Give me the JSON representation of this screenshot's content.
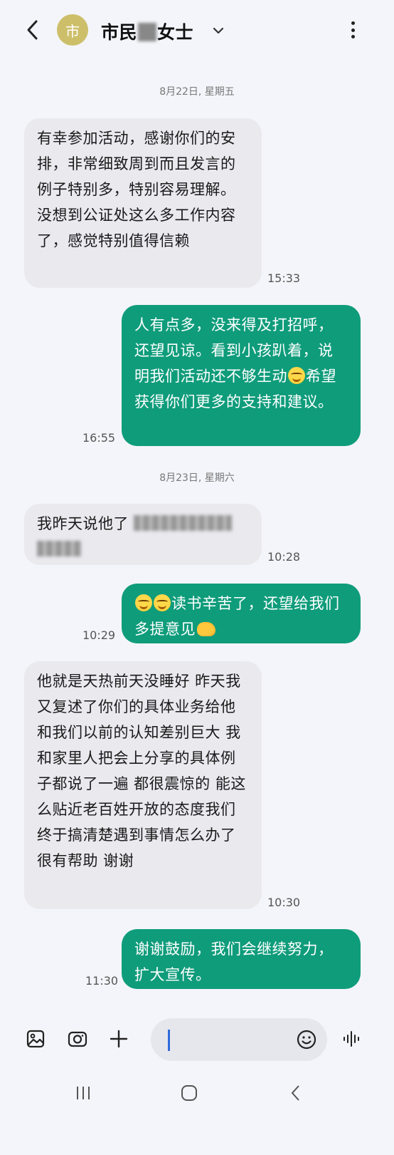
{
  "header": {
    "avatar_char": "市",
    "name_prefix": "市民",
    "name_suffix": "女士"
  },
  "messages": [
    {
      "type": "date",
      "text": "8月22日, 星期五"
    },
    {
      "type": "in",
      "text": "有幸参加活动，感谢你们的安排，非常细致周到而且发言的例子特别多，特别容易理解。没想到公证处这么多工作内容了，感觉特别值得信赖",
      "time": "15:33"
    },
    {
      "type": "out",
      "text_a": "人有点多，没来得及打招呼，还望见谅。看到小孩趴着，说明我们活动还不够生动",
      "text_b": "希望获得你们更多的支持和建议。",
      "time": "16:55"
    },
    {
      "type": "date",
      "text": "8月23日, 星期六"
    },
    {
      "type": "in",
      "text": "我昨天说他了",
      "time": "10:28"
    },
    {
      "type": "out",
      "text": "读书辛苦了，还望给我们多提意见",
      "time": "10:29"
    },
    {
      "type": "in",
      "text": "他就是天热前天没睡好 昨天我又复述了你们的具体业务给他 和我们以前的认知差别巨大 我和家里人把会上分享的具体例子都说了一遍 都很震惊的 能这么贴近老百姓开放的态度我们终于搞清楚遇到事情怎么办了 很有帮助 谢谢",
      "time": "10:30"
    },
    {
      "type": "out",
      "text": "谢谢鼓励，我们会继续努力，扩大宣传。",
      "time": "11:30"
    }
  ],
  "icons": {
    "back": "back-arrow-icon",
    "more": "more-vertical-icon",
    "gallery": "gallery-icon",
    "camera": "camera-icon",
    "add": "plus-icon",
    "emoji": "emoji-icon",
    "voice": "voice-wave-icon"
  },
  "colors": {
    "outgoing_bubble": "#0f9c7b",
    "incoming_bubble": "#e9e9ee",
    "avatar": "#cdbf6a",
    "background": "#f4f5fa"
  }
}
